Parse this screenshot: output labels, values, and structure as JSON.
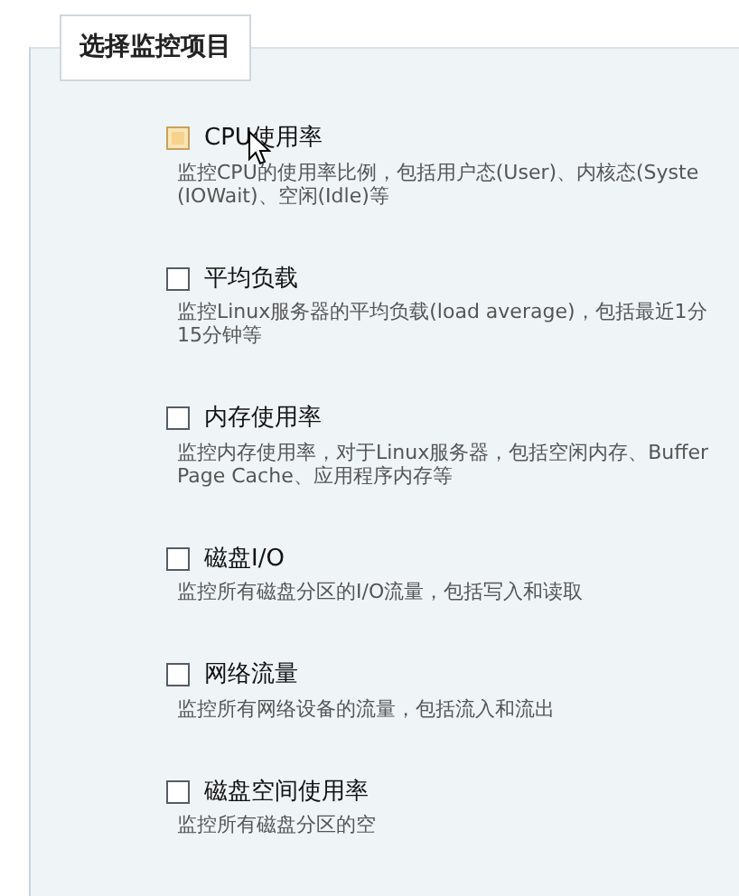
{
  "legend": "选择监控项目",
  "items": [
    {
      "label": "CPU使用率",
      "checked": false,
      "hovered": true,
      "description": [
        "监控CPU的使用率比例，包括用户态(User)、内核态(Syste",
        "(IOWait)、空闲(Idle)等"
      ]
    },
    {
      "label": "平均负载",
      "checked": false,
      "hovered": false,
      "description": [
        "监控Linux服务器的平均负载(load average)，包括最近1分",
        "15分钟等"
      ]
    },
    {
      "label": "内存使用率",
      "checked": false,
      "hovered": false,
      "description": [
        "监控内存使用率，对于Linux服务器，包括空闲内存、Buffer",
        "Page Cache、应用程序内存等"
      ]
    },
    {
      "label": "磁盘I/O",
      "checked": false,
      "hovered": false,
      "description": [
        "监控所有磁盘分区的I/O流量，包括写入和读取"
      ]
    },
    {
      "label": "网络流量",
      "checked": false,
      "hovered": false,
      "description": [
        "监控所有网络设备的流量，包括流入和流出"
      ]
    },
    {
      "label": "磁盘空间使用率",
      "checked": false,
      "hovered": false,
      "description": [
        "监控所有磁盘分区的空"
      ]
    }
  ]
}
